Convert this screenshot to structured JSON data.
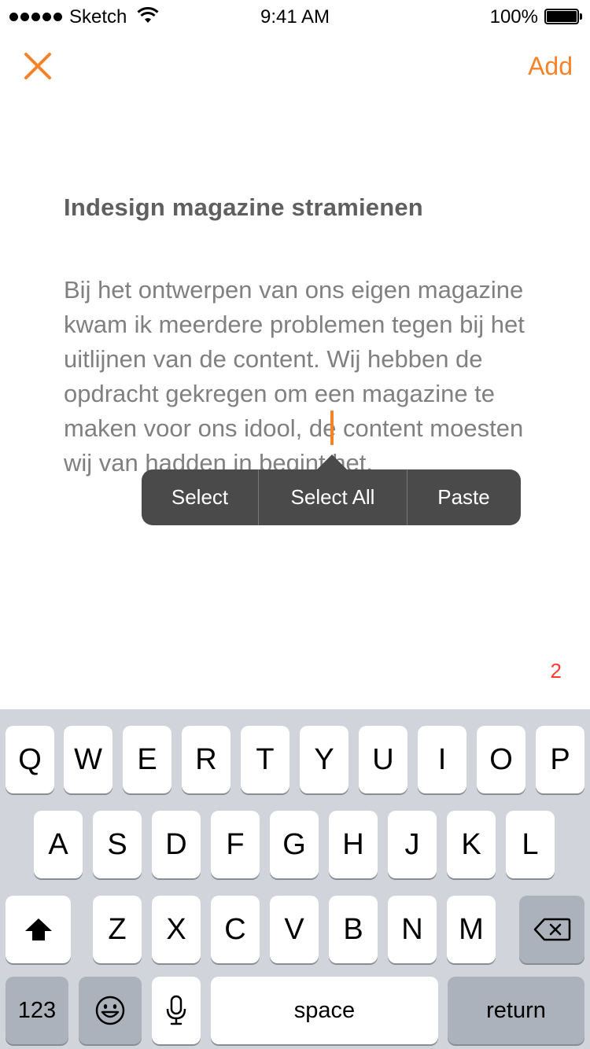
{
  "status_bar": {
    "carrier": "Sketch",
    "time": "9:41 AM",
    "battery": "100%"
  },
  "nav": {
    "close_icon": "close-icon",
    "add_label": "Add",
    "accent_color": "#f5832a"
  },
  "note": {
    "title": "Indesign magazine stramienen",
    "body": "Bij het ontwerpen van ons eigen magazine kwam ik meerdere problemen tegen bij het uitlijnen van de content. Wij hebben de opdracht gekregen om een magazine te maken voor ons idool, de content moesten wij van hadden in begint het.",
    "counter": "2"
  },
  "edit_menu": {
    "items": [
      "Select",
      "Select All",
      "Paste"
    ]
  },
  "keyboard": {
    "row1": [
      "Q",
      "W",
      "E",
      "R",
      "T",
      "Y",
      "U",
      "I",
      "O",
      "P"
    ],
    "row2": [
      "A",
      "S",
      "D",
      "F",
      "G",
      "H",
      "J",
      "K",
      "L"
    ],
    "row3": [
      "Z",
      "X",
      "C",
      "V",
      "B",
      "N",
      "M"
    ],
    "shift_icon": "shift-icon",
    "backspace_icon": "backspace-icon",
    "numbers_label": "123",
    "emoji_icon": "emoji-icon",
    "mic_icon": "microphone-icon",
    "space_label": "space",
    "return_label": "return"
  }
}
